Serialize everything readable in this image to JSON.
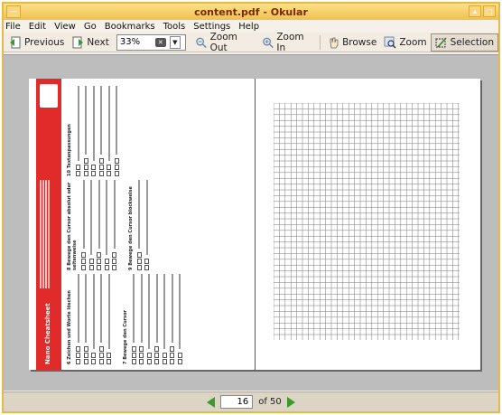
{
  "window": {
    "title": "content.pdf - Okular"
  },
  "menu": [
    "File",
    "Edit",
    "View",
    "Go",
    "Bookmarks",
    "Tools",
    "Settings",
    "Help"
  ],
  "toolbar": {
    "previous": "Previous",
    "next": "Next",
    "zoom_value": "33%",
    "zoom_out": "Zoom Out",
    "zoom_in": "Zoom In",
    "browse": "Browse",
    "zoom": "Zoom",
    "selection": "Selection"
  },
  "document": {
    "cheatsheet_title": "Nano Cheatsheet",
    "sections": [
      "6 Zeichen und Worte löschen",
      "7 Bewege den Cursor",
      "8 Bewege den Cursor absolut oder seitenweise",
      "9 Bewege den Cursor blockweise",
      "10 Textanpassungen"
    ]
  },
  "status": {
    "current_page": "16",
    "of_label": "of 50"
  },
  "colors": {
    "accent": "#e12a2a",
    "nav": "#3a9a2a",
    "titlebar": "#f1c04e"
  }
}
